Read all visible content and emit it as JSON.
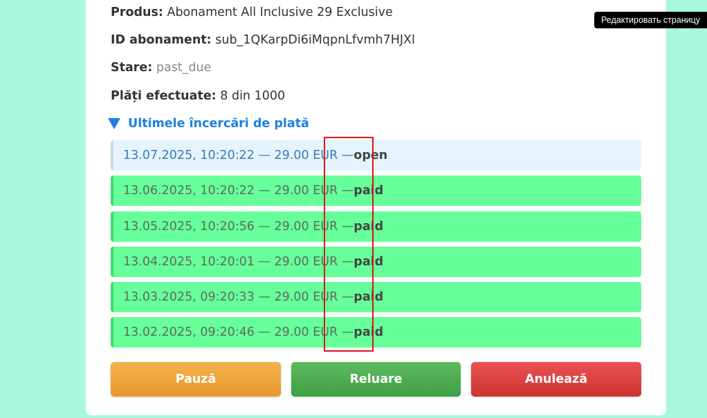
{
  "fields": {
    "product_label": "Produs:",
    "product_value": "Abonament All Inclusive 29 Exclusive",
    "id_label": "ID abonament:",
    "id_value": "sub_1QKarpDi6iMqpnLfvmh7HJXl",
    "status_label": "Stare:",
    "status_value": "past_due",
    "payments_label": "Plăți efectuate:",
    "payments_value": "8 din 1000"
  },
  "attempts": {
    "toggle_label": "Ultimele încercări de plată",
    "rows": [
      {
        "text": "13.07.2025, 10:20:22 — 29.00 EUR — ",
        "status": "open"
      },
      {
        "text": "13.06.2025, 10:20:22 — 29.00 EUR — ",
        "status": "paid"
      },
      {
        "text": "13.05.2025, 10:20:56 — 29.00 EUR — ",
        "status": "paid"
      },
      {
        "text": "13.04.2025, 10:20:01 — 29.00 EUR — ",
        "status": "paid"
      },
      {
        "text": "13.03.2025, 09:20:33 — 29.00 EUR — ",
        "status": "paid"
      },
      {
        "text": "13.02.2025, 09:20:46 — 29.00 EUR — ",
        "status": "paid"
      }
    ]
  },
  "actions": {
    "pause_label": "Pauză",
    "resume_label": "Reluare",
    "cancel_label": "Anulează"
  },
  "admin": {
    "edit_page_label": "Редактировать страницу"
  },
  "colors": {
    "page_background": "#a8f8dc",
    "row_paid": "#66ff99",
    "row_open": "#e4f3fc",
    "link_blue": "#1e7fe0",
    "pause_orange": "#e9992a",
    "resume_green": "#3f9f45",
    "cancel_red": "#cc3434",
    "highlight_red": "#e01515"
  }
}
